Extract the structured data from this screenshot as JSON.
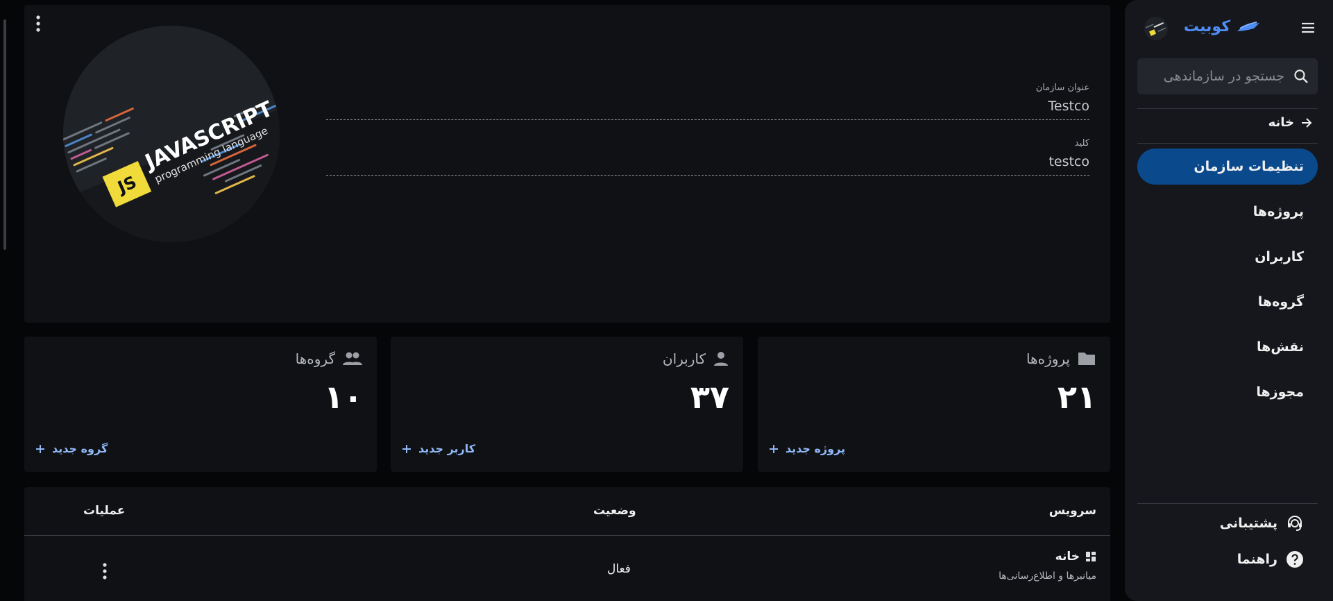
{
  "colors": {
    "background": "#050608",
    "panel": "#0f1115",
    "sidebar": "#15171c",
    "active_nav": "#0a4a8c",
    "brand": "#4f8df5",
    "link": "#8fb8f5"
  },
  "sidebar": {
    "brand_name": "کوبیت",
    "search": {
      "placeholder": "جستجو در سازماندهی",
      "value": ""
    },
    "home_link": "خانه",
    "nav": [
      {
        "label": "تنظیمات سازمان",
        "active": true
      },
      {
        "label": "پروژه‌ها",
        "active": false
      },
      {
        "label": "کاربران",
        "active": false
      },
      {
        "label": "گروه‌ها",
        "active": false
      },
      {
        "label": "نقش‌ها",
        "active": false
      },
      {
        "label": "مجوزها",
        "active": false
      }
    ],
    "bottom": [
      {
        "label": "پشتیبانی",
        "icon": "support-agent-icon"
      },
      {
        "label": "راهنما",
        "icon": "help-circle-icon"
      }
    ]
  },
  "organization": {
    "logo_alt": "JAVASCRIPT programming language",
    "logo_badge": "JS",
    "logo_text": "JAVASCRIPT",
    "logo_subtext": "programming language",
    "title_label": "عنوان سازمان",
    "title_value": "Testco",
    "key_label": "کلید",
    "key_value": "testco"
  },
  "stats": {
    "projects": {
      "label": "پروژه‌ها",
      "count": "۲۱",
      "action": "پروژه جدید",
      "icon": "folder-icon"
    },
    "users": {
      "label": "کاربران",
      "count": "۳۷",
      "action": "کاربر جدید",
      "icon": "person-icon"
    },
    "groups": {
      "label": "گروه‌ها",
      "count": "۱۰",
      "action": "گروه جدید",
      "icon": "group-icon"
    }
  },
  "services_table": {
    "headers": {
      "service": "سرویس",
      "status": "وضعیت",
      "actions": "عملیات"
    },
    "rows": [
      {
        "title": "خانه",
        "subtitle": "میانبرها و اطلاع‌رسانی‌ها",
        "status": "فعال",
        "icon": "dashboard-icon"
      }
    ]
  }
}
